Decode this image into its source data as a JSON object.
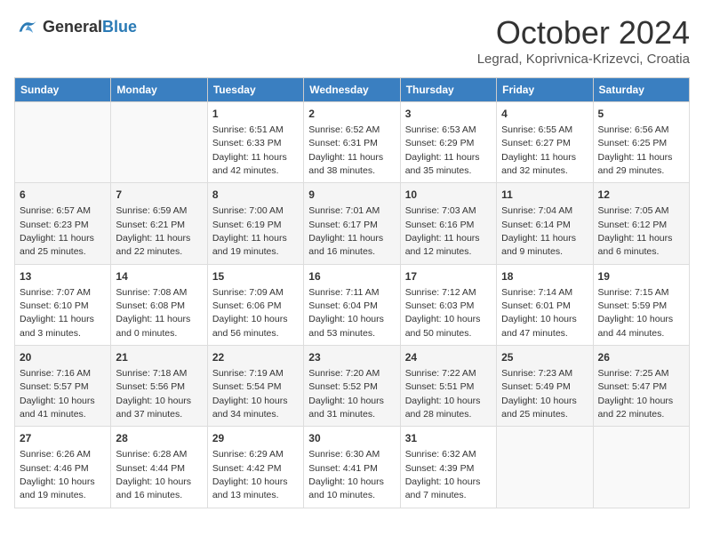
{
  "header": {
    "logo_general": "General",
    "logo_blue": "Blue",
    "month_title": "October 2024",
    "location": "Legrad, Koprivnica-Krizevci, Croatia"
  },
  "weekdays": [
    "Sunday",
    "Monday",
    "Tuesday",
    "Wednesday",
    "Thursday",
    "Friday",
    "Saturday"
  ],
  "weeks": [
    [
      {
        "day": "",
        "data": ""
      },
      {
        "day": "",
        "data": ""
      },
      {
        "day": "1",
        "data": "Sunrise: 6:51 AM\nSunset: 6:33 PM\nDaylight: 11 hours and 42 minutes."
      },
      {
        "day": "2",
        "data": "Sunrise: 6:52 AM\nSunset: 6:31 PM\nDaylight: 11 hours and 38 minutes."
      },
      {
        "day": "3",
        "data": "Sunrise: 6:53 AM\nSunset: 6:29 PM\nDaylight: 11 hours and 35 minutes."
      },
      {
        "day": "4",
        "data": "Sunrise: 6:55 AM\nSunset: 6:27 PM\nDaylight: 11 hours and 32 minutes."
      },
      {
        "day": "5",
        "data": "Sunrise: 6:56 AM\nSunset: 6:25 PM\nDaylight: 11 hours and 29 minutes."
      }
    ],
    [
      {
        "day": "6",
        "data": "Sunrise: 6:57 AM\nSunset: 6:23 PM\nDaylight: 11 hours and 25 minutes."
      },
      {
        "day": "7",
        "data": "Sunrise: 6:59 AM\nSunset: 6:21 PM\nDaylight: 11 hours and 22 minutes."
      },
      {
        "day": "8",
        "data": "Sunrise: 7:00 AM\nSunset: 6:19 PM\nDaylight: 11 hours and 19 minutes."
      },
      {
        "day": "9",
        "data": "Sunrise: 7:01 AM\nSunset: 6:17 PM\nDaylight: 11 hours and 16 minutes."
      },
      {
        "day": "10",
        "data": "Sunrise: 7:03 AM\nSunset: 6:16 PM\nDaylight: 11 hours and 12 minutes."
      },
      {
        "day": "11",
        "data": "Sunrise: 7:04 AM\nSunset: 6:14 PM\nDaylight: 11 hours and 9 minutes."
      },
      {
        "day": "12",
        "data": "Sunrise: 7:05 AM\nSunset: 6:12 PM\nDaylight: 11 hours and 6 minutes."
      }
    ],
    [
      {
        "day": "13",
        "data": "Sunrise: 7:07 AM\nSunset: 6:10 PM\nDaylight: 11 hours and 3 minutes."
      },
      {
        "day": "14",
        "data": "Sunrise: 7:08 AM\nSunset: 6:08 PM\nDaylight: 11 hours and 0 minutes."
      },
      {
        "day": "15",
        "data": "Sunrise: 7:09 AM\nSunset: 6:06 PM\nDaylight: 10 hours and 56 minutes."
      },
      {
        "day": "16",
        "data": "Sunrise: 7:11 AM\nSunset: 6:04 PM\nDaylight: 10 hours and 53 minutes."
      },
      {
        "day": "17",
        "data": "Sunrise: 7:12 AM\nSunset: 6:03 PM\nDaylight: 10 hours and 50 minutes."
      },
      {
        "day": "18",
        "data": "Sunrise: 7:14 AM\nSunset: 6:01 PM\nDaylight: 10 hours and 47 minutes."
      },
      {
        "day": "19",
        "data": "Sunrise: 7:15 AM\nSunset: 5:59 PM\nDaylight: 10 hours and 44 minutes."
      }
    ],
    [
      {
        "day": "20",
        "data": "Sunrise: 7:16 AM\nSunset: 5:57 PM\nDaylight: 10 hours and 41 minutes."
      },
      {
        "day": "21",
        "data": "Sunrise: 7:18 AM\nSunset: 5:56 PM\nDaylight: 10 hours and 37 minutes."
      },
      {
        "day": "22",
        "data": "Sunrise: 7:19 AM\nSunset: 5:54 PM\nDaylight: 10 hours and 34 minutes."
      },
      {
        "day": "23",
        "data": "Sunrise: 7:20 AM\nSunset: 5:52 PM\nDaylight: 10 hours and 31 minutes."
      },
      {
        "day": "24",
        "data": "Sunrise: 7:22 AM\nSunset: 5:51 PM\nDaylight: 10 hours and 28 minutes."
      },
      {
        "day": "25",
        "data": "Sunrise: 7:23 AM\nSunset: 5:49 PM\nDaylight: 10 hours and 25 minutes."
      },
      {
        "day": "26",
        "data": "Sunrise: 7:25 AM\nSunset: 5:47 PM\nDaylight: 10 hours and 22 minutes."
      }
    ],
    [
      {
        "day": "27",
        "data": "Sunrise: 6:26 AM\nSunset: 4:46 PM\nDaylight: 10 hours and 19 minutes."
      },
      {
        "day": "28",
        "data": "Sunrise: 6:28 AM\nSunset: 4:44 PM\nDaylight: 10 hours and 16 minutes."
      },
      {
        "day": "29",
        "data": "Sunrise: 6:29 AM\nSunset: 4:42 PM\nDaylight: 10 hours and 13 minutes."
      },
      {
        "day": "30",
        "data": "Sunrise: 6:30 AM\nSunset: 4:41 PM\nDaylight: 10 hours and 10 minutes."
      },
      {
        "day": "31",
        "data": "Sunrise: 6:32 AM\nSunset: 4:39 PM\nDaylight: 10 hours and 7 minutes."
      },
      {
        "day": "",
        "data": ""
      },
      {
        "day": "",
        "data": ""
      }
    ]
  ]
}
